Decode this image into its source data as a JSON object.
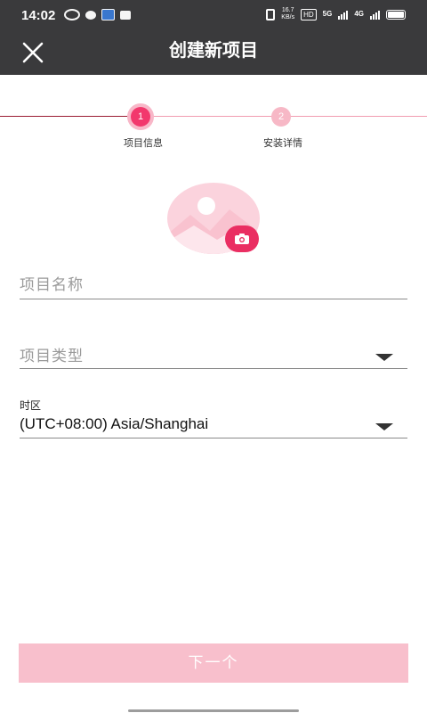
{
  "status_bar": {
    "time": "14:02",
    "net_speed_value": "16.7",
    "net_speed_unit": "KB/s",
    "hd_label": "HD",
    "net_label_1": "5G",
    "net_label_2": "4G"
  },
  "app_bar": {
    "title": "创建新项目",
    "close_icon": "close-icon"
  },
  "stepper": {
    "steps": [
      {
        "number": "1",
        "label": "项目信息",
        "state": "active"
      },
      {
        "number": "2",
        "label": "安装详情",
        "state": "inactive"
      }
    ]
  },
  "form": {
    "project_name": {
      "placeholder": "项目名称",
      "value": ""
    },
    "project_type": {
      "placeholder": "项目类型",
      "value": ""
    },
    "timezone": {
      "label": "时区",
      "value": "(UTC+08:00) Asia/Shanghai"
    }
  },
  "next_button": {
    "label": "下一个"
  },
  "colors": {
    "accent": "#f2386d",
    "accent_light": "#f8bfcc",
    "bar_bg": "#3a3a3c"
  }
}
